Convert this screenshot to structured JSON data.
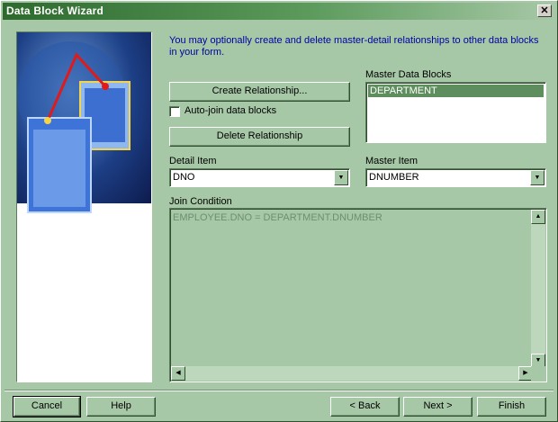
{
  "window": {
    "title": "Data Block Wizard",
    "close_glyph": "✕"
  },
  "intro_text": "You may optionally create and delete master-detail relationships to other data blocks in your form.",
  "buttons": {
    "create_relationship": "Create Relationship...",
    "delete_relationship": "Delete Relationship"
  },
  "checkbox": {
    "label": "Auto-join data blocks",
    "checked": false
  },
  "master_data_blocks": {
    "label": "Master Data Blocks",
    "items": [
      "DEPARTMENT"
    ]
  },
  "detail_item": {
    "label": "Detail Item",
    "value": "DNO"
  },
  "master_item": {
    "label": "Master Item",
    "value": "DNUMBER"
  },
  "join_condition": {
    "label": "Join Condition",
    "value": "EMPLOYEE.DNO = DEPARTMENT.DNUMBER"
  },
  "footer": {
    "cancel": "Cancel",
    "help": "Help",
    "back": "< Back",
    "next": "Next >",
    "finish": "Finish"
  },
  "icons": {
    "scroll_up": "▲",
    "scroll_down": "▼",
    "scroll_left": "◀",
    "scroll_right": "▶",
    "dropdown": "▼"
  },
  "colors": {
    "background": "#a7c8a7",
    "title_bar": "#2e6a2e",
    "intro_text": "#0000a0",
    "selection": "#5e8e5e"
  }
}
